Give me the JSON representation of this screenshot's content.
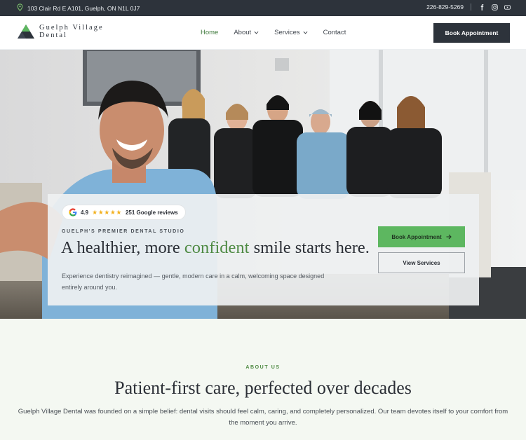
{
  "topbar": {
    "address": "103 Clair Rd E A101, Guelph, ON N1L 0J7",
    "phone": "226-829-5269",
    "social": [
      "facebook-icon",
      "instagram-icon",
      "youtube-icon"
    ]
  },
  "header": {
    "logo_line1": "Guelph Village",
    "logo_line2": "Dental",
    "nav": [
      {
        "label": "Home",
        "active": true,
        "has_dropdown": false
      },
      {
        "label": "About",
        "active": false,
        "has_dropdown": true
      },
      {
        "label": "Services",
        "active": false,
        "has_dropdown": true
      },
      {
        "label": "Contact",
        "active": false,
        "has_dropdown": false
      }
    ],
    "cta": "Book Appointment"
  },
  "hero": {
    "rating": "4.9",
    "stars": "★★★★★",
    "reviews": "251 Google reviews",
    "kicker": "GUELPH'S PREMIER DENTAL STUDIO",
    "headline_pre": "A healthier, more ",
    "headline_accent": "confident",
    "headline_post": " smile starts here.",
    "sub": "Experience dentistry reimagined — gentle, modern care in a calm, welcoming space designed entirely around you.",
    "primary_button": "Book Appointment",
    "secondary_button": "View Services"
  },
  "about": {
    "eyebrow": "ABOUT US",
    "title": "Patient-first care, perfected over decades",
    "body": "Guelph Village Dental was founded on a simple belief: dental visits should feel calm, caring, and completely personalized. Our team devotes itself to your comfort from the moment you arrive."
  },
  "colors": {
    "dark": "#2d333b",
    "accent_green": "#4e8a43",
    "button_green": "#5db760",
    "star": "#f2b01e",
    "about_bg": "#f4f8f2"
  }
}
